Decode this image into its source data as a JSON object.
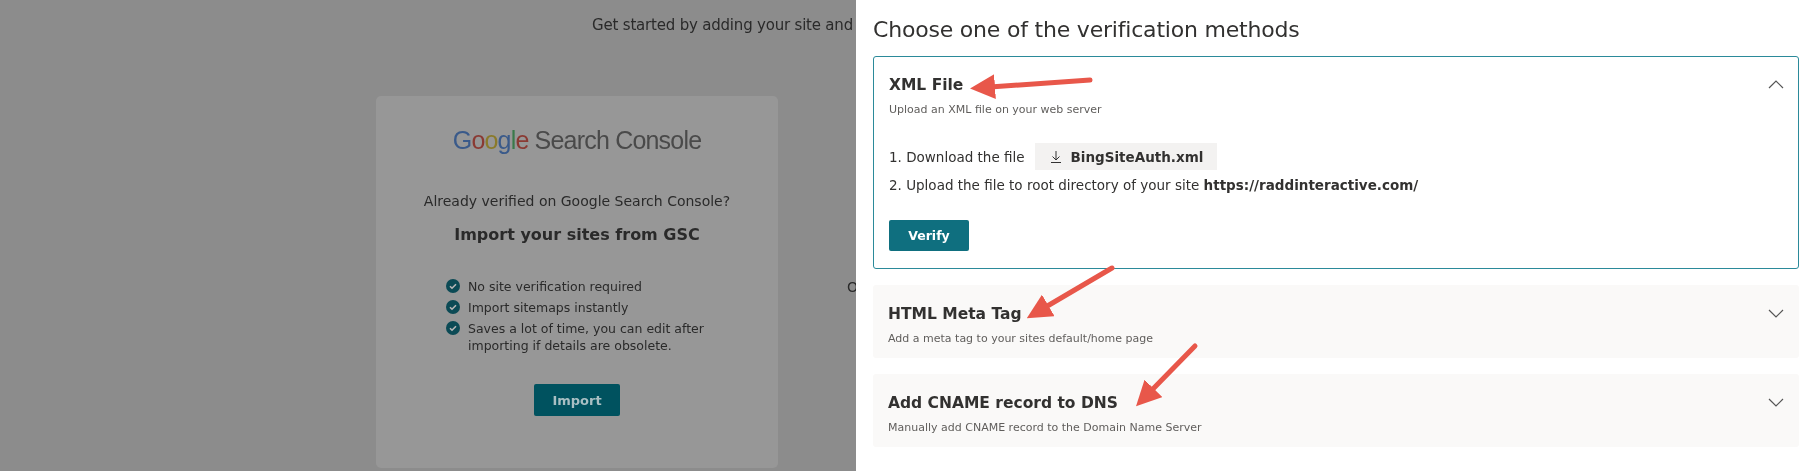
{
  "background": {
    "intro": "Get started by adding your site and",
    "edge_letter": "O",
    "import_card": {
      "logo": {
        "brand": "Google",
        "product": "Search Console"
      },
      "question": "Already verified on Google Search Console?",
      "heading": "Import your sites from GSC",
      "benefits": [
        "No site verification required",
        "Import sitemaps instantly",
        "Saves a lot of time, you can edit after importing if details are obsolete."
      ],
      "button": "Import"
    }
  },
  "panel": {
    "title": "Choose one of the verification methods",
    "methods": [
      {
        "title": "XML File",
        "subtitle": "Upload an XML file on your web server",
        "expanded": true,
        "steps": [
          {
            "kind": "download",
            "text": "1. Download the file",
            "file": "BingSiteAuth.xml"
          },
          {
            "kind": "link",
            "text": "2. Upload the file to root directory of your site",
            "url": "https://raddinteractive.com/"
          }
        ],
        "button": "Verify"
      },
      {
        "title": "HTML Meta Tag",
        "subtitle": "Add a meta tag to your sites default/home page",
        "expanded": false
      },
      {
        "title": "Add CNAME record to DNS",
        "subtitle": "Manually add CNAME record to the Domain Name Server",
        "expanded": false
      }
    ]
  }
}
